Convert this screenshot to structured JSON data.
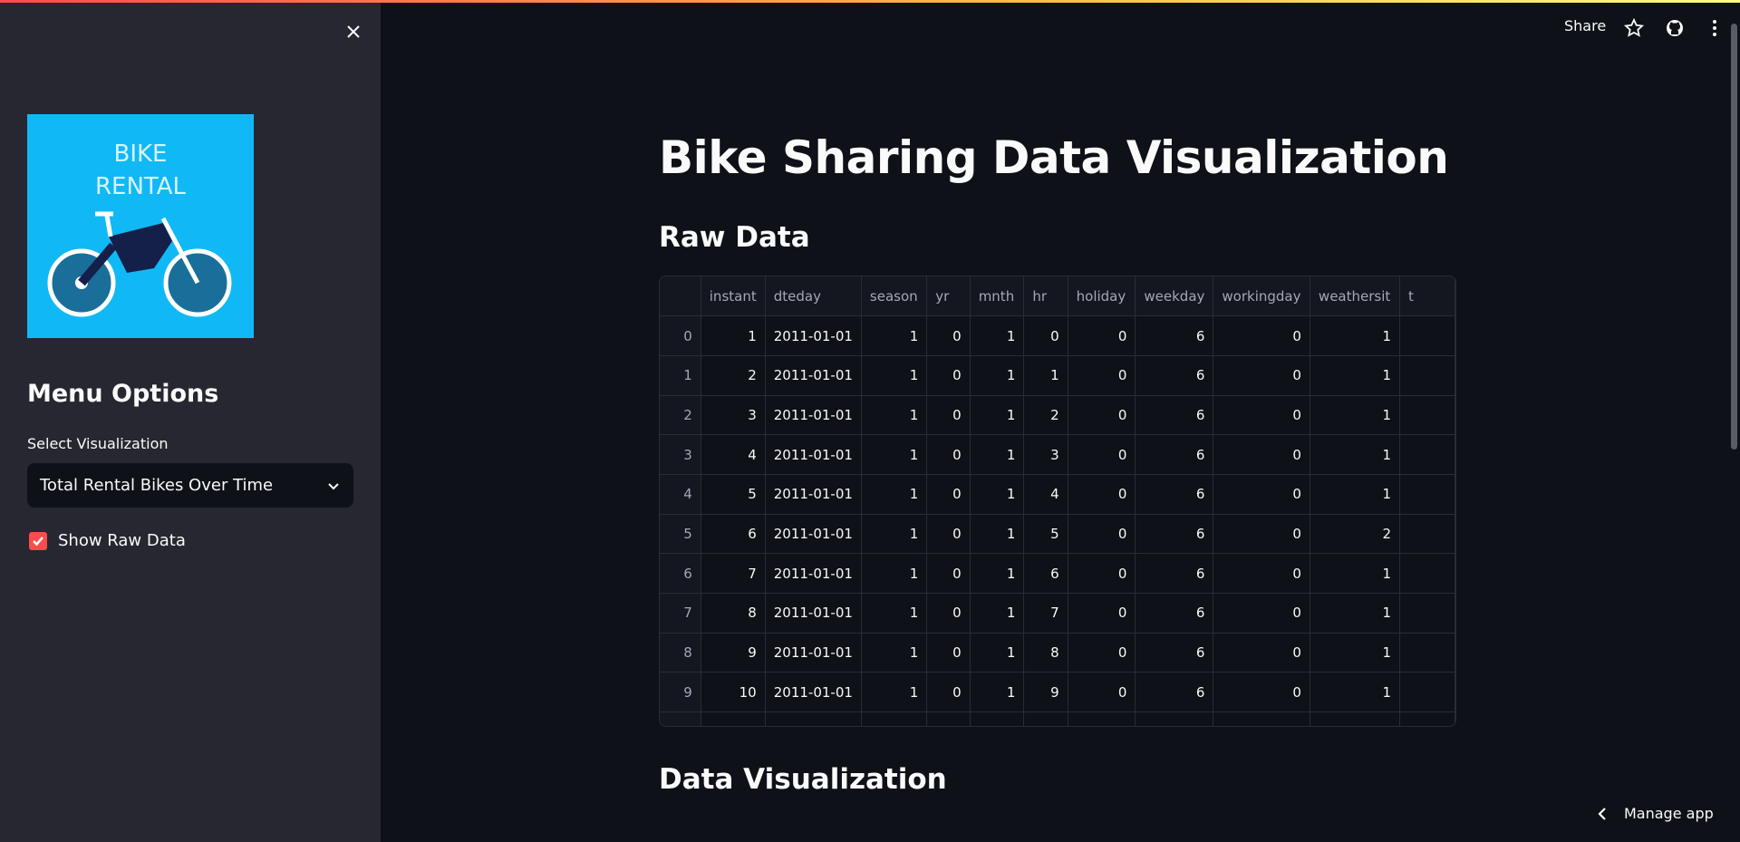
{
  "colors": {
    "accent": "#ff4b4b",
    "sidebar_bg": "#262730",
    "main_bg": "#0e1117",
    "logo_bg": "#10b9f5"
  },
  "sidebar": {
    "logo_text": [
      "BIKE",
      "RENTAL"
    ],
    "menu_title": "Menu Options",
    "select_label": "Select Visualization",
    "select_value": "Total Rental Bikes Over Time",
    "checkbox_label": "Show Raw Data",
    "checkbox_checked": true
  },
  "header": {
    "share": "Share",
    "icons": [
      "star-icon",
      "github-icon",
      "more-vert-icon"
    ]
  },
  "main": {
    "title": "Bike Sharing Data Visualization",
    "raw_data_heading": "Raw Data",
    "viz_heading": "Data Visualization",
    "table": {
      "columns": [
        "",
        "instant",
        "dteday",
        "season",
        "yr",
        "mnth",
        "hr",
        "holiday",
        "weekday",
        "workingday",
        "weathersit",
        "t"
      ],
      "rows": [
        [
          "0",
          "1",
          "2011-01-01",
          "1",
          "0",
          "1",
          "0",
          "0",
          "6",
          "0",
          "1"
        ],
        [
          "1",
          "2",
          "2011-01-01",
          "1",
          "0",
          "1",
          "1",
          "0",
          "6",
          "0",
          "1"
        ],
        [
          "2",
          "3",
          "2011-01-01",
          "1",
          "0",
          "1",
          "2",
          "0",
          "6",
          "0",
          "1"
        ],
        [
          "3",
          "4",
          "2011-01-01",
          "1",
          "0",
          "1",
          "3",
          "0",
          "6",
          "0",
          "1"
        ],
        [
          "4",
          "5",
          "2011-01-01",
          "1",
          "0",
          "1",
          "4",
          "0",
          "6",
          "0",
          "1"
        ],
        [
          "5",
          "6",
          "2011-01-01",
          "1",
          "0",
          "1",
          "5",
          "0",
          "6",
          "0",
          "2"
        ],
        [
          "6",
          "7",
          "2011-01-01",
          "1",
          "0",
          "1",
          "6",
          "0",
          "6",
          "0",
          "1"
        ],
        [
          "7",
          "8",
          "2011-01-01",
          "1",
          "0",
          "1",
          "7",
          "0",
          "6",
          "0",
          "1"
        ],
        [
          "8",
          "9",
          "2011-01-01",
          "1",
          "0",
          "1",
          "8",
          "0",
          "6",
          "0",
          "1"
        ],
        [
          "9",
          "10",
          "2011-01-01",
          "1",
          "0",
          "1",
          "9",
          "0",
          "6",
          "0",
          "1"
        ]
      ]
    }
  },
  "footer": {
    "manage_app": "Manage app"
  }
}
